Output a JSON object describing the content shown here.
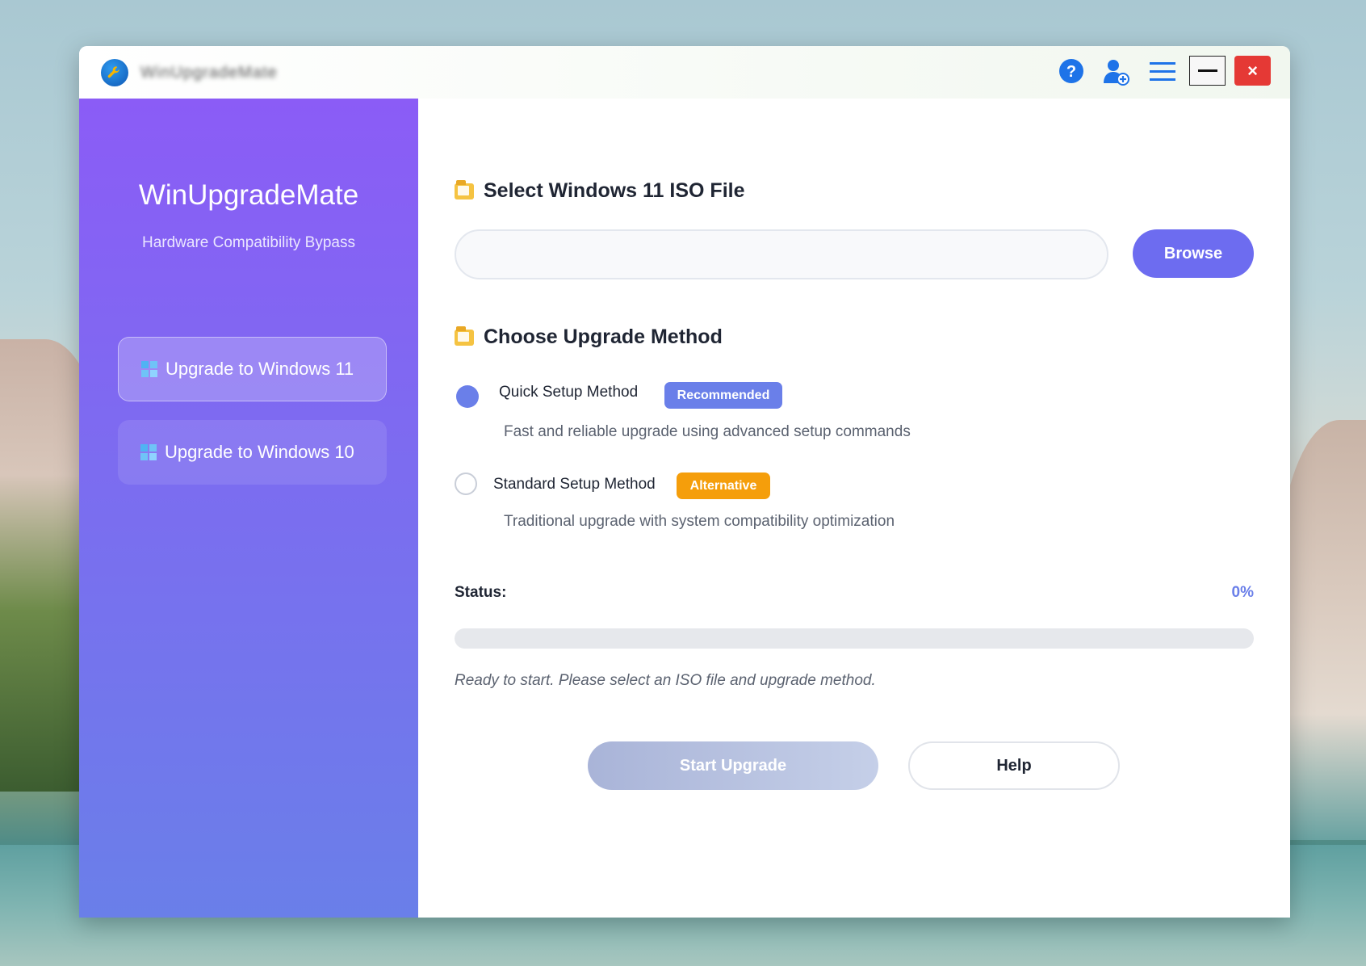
{
  "window": {
    "title": "WinUpgradeMate"
  },
  "titlebar": {
    "icons": [
      "help-icon",
      "user-add-icon",
      "menu-icon",
      "minimize-icon",
      "close-icon"
    ],
    "close_glyph": "×"
  },
  "sidebar": {
    "brand": "WinUpgradeMate",
    "tagline": "Hardware Compatibility Bypass",
    "items": [
      {
        "label": "Upgrade to Windows 11",
        "icon": "windows-icon",
        "active": true
      },
      {
        "label": "Upgrade to Windows 10",
        "icon": "windows-icon",
        "active": false
      }
    ]
  },
  "iso": {
    "section_title": "Select Windows 11 ISO File",
    "section_icon": "folder-icon",
    "input_value": "",
    "input_placeholder": "",
    "browse_label": "Browse"
  },
  "method": {
    "section_title": "Choose Upgrade Method",
    "section_icon": "folder-icon",
    "options": [
      {
        "label": "Quick Setup Method",
        "badge": "Recommended",
        "description": "Fast and reliable upgrade using advanced setup commands",
        "selected": true
      },
      {
        "label": "Standard Setup Method",
        "badge": "Alternative",
        "description": "Traditional upgrade with system compatibility optimization",
        "selected": false
      }
    ]
  },
  "status": {
    "label": "Status:",
    "percent_text": "0%",
    "progress_fraction": 0,
    "message": "Ready to start. Please select an ISO file and upgrade method."
  },
  "actions": {
    "start_label": "Start Upgrade",
    "help_label": "Help"
  },
  "colors": {
    "sidebar_top": "#8b5cf6",
    "sidebar_bottom": "#6a7fe9",
    "accent": "#6a7fe9",
    "browse_button": "#6d6cf0",
    "recommended_badge": "#6a7fe9",
    "alternative_badge": "#f59e0b",
    "close_button": "#e53935"
  }
}
